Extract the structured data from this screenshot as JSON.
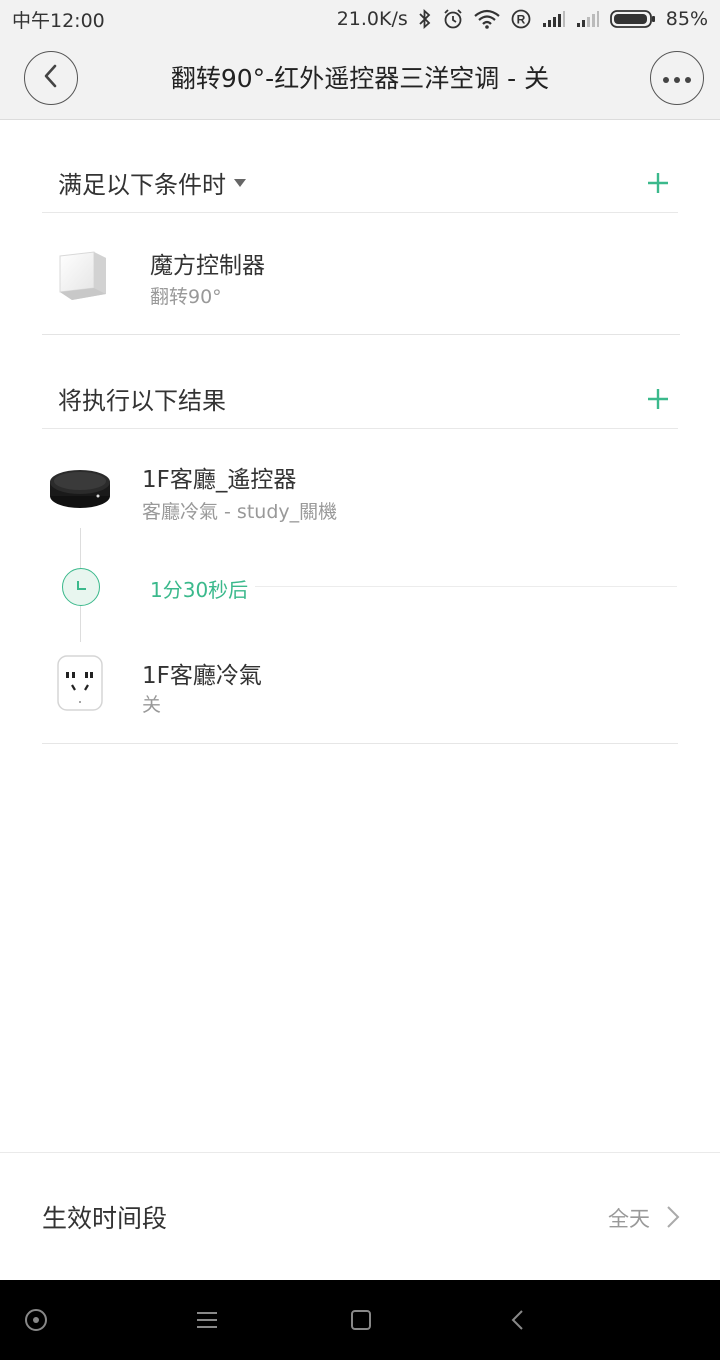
{
  "status_bar": {
    "time": "中午12:00",
    "speed": "21.0K/s",
    "battery": "85%",
    "icons": [
      "bluetooth-icon",
      "alarm-icon",
      "wifi-icon",
      "roaming-icon",
      "signal-icon",
      "signal-icon",
      "battery-icon"
    ]
  },
  "header": {
    "title": "翻转90°-红外遥控器三洋空调 - 关",
    "back_icon": "back-arrow-icon",
    "more_icon": "more-dots-icon"
  },
  "conditions": {
    "label": "满足以下条件时",
    "add_icon": "plus-icon",
    "items": [
      {
        "name": "魔方控制器",
        "detail": "翻转90°",
        "icon": "cube-controller-icon"
      }
    ]
  },
  "actions": {
    "label": "将执行以下结果",
    "add_icon": "plus-icon",
    "items": [
      {
        "name": "1F客廳_遙控器",
        "detail": "客廳冷氣 - study_關機",
        "icon": "ir-remote-icon"
      },
      {
        "name": "1F客廳冷氣",
        "detail": "关",
        "icon": "smart-plug-icon"
      }
    ],
    "delay": "1分30秒后"
  },
  "effective_period": {
    "label": "生效时间段",
    "value": "全天"
  },
  "colors": {
    "accent": "#3bb98c",
    "header_bg": "#f2f2f2"
  }
}
